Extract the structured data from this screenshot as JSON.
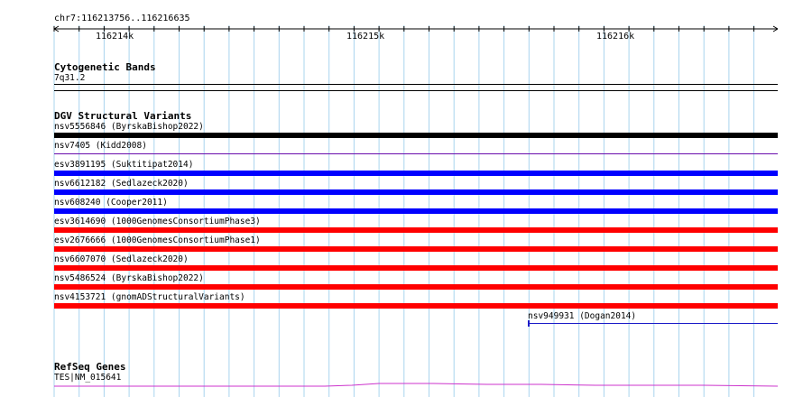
{
  "locus": "chr7:116213756..116216635",
  "ruler": {
    "ticks": [
      "116214k",
      "116215k",
      "116216k"
    ]
  },
  "colors": {
    "grid": "#a9d4ee",
    "black": "#000000",
    "blue": "#0000ff",
    "red": "#ff0000",
    "purple": "#6a0dad",
    "navy": "#1c1cc8",
    "magenta": "#cc33cc"
  },
  "tracks": {
    "cytoband": {
      "title": "Cytogenetic Bands",
      "band": "7q31.2"
    },
    "dgv": {
      "title": "DGV Structural Variants",
      "variants": [
        {
          "label": "nsv5556846 (ByrskaBishop2022)",
          "color": "black",
          "style": "thick"
        },
        {
          "label": "nsv7405 (Kidd2008)",
          "color": "purple",
          "style": "thin"
        },
        {
          "label": "esv3891195 (Suktitipat2014)",
          "color": "blue",
          "style": "thick"
        },
        {
          "label": "nsv6612182 (Sedlazeck2020)",
          "color": "blue",
          "style": "thick"
        },
        {
          "label": "nsv608240 (Cooper2011)",
          "color": "blue",
          "style": "thick"
        },
        {
          "label": "esv3614690 (1000GenomesConsortiumPhase3)",
          "color": "red",
          "style": "thick"
        },
        {
          "label": "esv2676666 (1000GenomesConsortiumPhase1)",
          "color": "red",
          "style": "thick"
        },
        {
          "label": "nsv6607070 (Sedlazeck2020)",
          "color": "red",
          "style": "thick"
        },
        {
          "label": "nsv5486524 (ByrskaBishop2022)",
          "color": "red",
          "style": "thick"
        },
        {
          "label": "nsv4153721 (gnomADStructuralVariants)",
          "color": "red",
          "style": "thick"
        }
      ],
      "partial": {
        "label": "nsv949931 (Dogan2014)",
        "color": "navy"
      }
    },
    "refseq": {
      "title": "RefSeq Genes",
      "gene": "TES|NM_015641"
    }
  }
}
